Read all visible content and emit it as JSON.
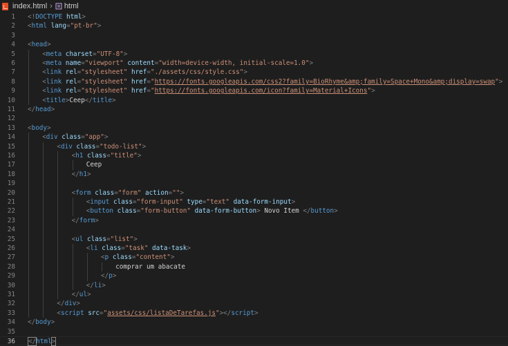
{
  "breadcrumbs": {
    "file": "index.html",
    "symbol": "html"
  },
  "editor": {
    "current_line": 36,
    "lines": [
      {
        "n": "1",
        "indent": 0,
        "tokens": [
          [
            "punct",
            "<!"
          ],
          [
            "doctype",
            "DOCTYPE"
          ],
          [
            "text",
            " "
          ],
          [
            "attr",
            "html"
          ],
          [
            "punct",
            ">"
          ]
        ]
      },
      {
        "n": "2",
        "indent": 0,
        "tokens": [
          [
            "punct",
            "<"
          ],
          [
            "tag",
            "html"
          ],
          [
            "text",
            " "
          ],
          [
            "attr",
            "lang"
          ],
          [
            "punct",
            "="
          ],
          [
            "str",
            "\"pt-br\""
          ],
          [
            "punct",
            ">"
          ]
        ]
      },
      {
        "n": "3",
        "indent": 0,
        "tokens": []
      },
      {
        "n": "4",
        "indent": 0,
        "tokens": [
          [
            "punct",
            "<"
          ],
          [
            "tag",
            "head"
          ],
          [
            "punct",
            ">"
          ]
        ]
      },
      {
        "n": "5",
        "indent": 1,
        "tokens": [
          [
            "punct",
            "<"
          ],
          [
            "tag",
            "meta"
          ],
          [
            "text",
            " "
          ],
          [
            "attr",
            "charset"
          ],
          [
            "punct",
            "="
          ],
          [
            "str",
            "\"UTF-8\""
          ],
          [
            "punct",
            ">"
          ]
        ]
      },
      {
        "n": "6",
        "indent": 1,
        "tokens": [
          [
            "punct",
            "<"
          ],
          [
            "tag",
            "meta"
          ],
          [
            "text",
            " "
          ],
          [
            "attr",
            "name"
          ],
          [
            "punct",
            "="
          ],
          [
            "str",
            "\"viewport\""
          ],
          [
            "text",
            " "
          ],
          [
            "attr",
            "content"
          ],
          [
            "punct",
            "="
          ],
          [
            "str",
            "\"width=device-width, initial-scale=1.0\""
          ],
          [
            "punct",
            ">"
          ]
        ]
      },
      {
        "n": "7",
        "indent": 1,
        "tokens": [
          [
            "punct",
            "<"
          ],
          [
            "tag",
            "link"
          ],
          [
            "text",
            " "
          ],
          [
            "attr",
            "rel"
          ],
          [
            "punct",
            "="
          ],
          [
            "str",
            "\"stylesheet\""
          ],
          [
            "text",
            " "
          ],
          [
            "attr",
            "href"
          ],
          [
            "punct",
            "="
          ],
          [
            "str",
            "\"./assets/css/style.css\""
          ],
          [
            "punct",
            ">"
          ]
        ]
      },
      {
        "n": "8",
        "indent": 1,
        "tokens": [
          [
            "punct",
            "<"
          ],
          [
            "tag",
            "link"
          ],
          [
            "text",
            " "
          ],
          [
            "attr",
            "rel"
          ],
          [
            "punct",
            "="
          ],
          [
            "str",
            "\"stylesheet\""
          ],
          [
            "text",
            " "
          ],
          [
            "attr",
            "href"
          ],
          [
            "punct",
            "="
          ],
          [
            "str",
            "\""
          ],
          [
            "link",
            "https://fonts.googleapis.com/css2?family=BioRhyme&amp;family=Space+Mono&amp;display=swap"
          ],
          [
            "str",
            "\""
          ],
          [
            "punct",
            ">"
          ]
        ]
      },
      {
        "n": "9",
        "indent": 1,
        "tokens": [
          [
            "punct",
            "<"
          ],
          [
            "tag",
            "link"
          ],
          [
            "text",
            " "
          ],
          [
            "attr",
            "rel"
          ],
          [
            "punct",
            "="
          ],
          [
            "str",
            "\"stylesheet\""
          ],
          [
            "text",
            " "
          ],
          [
            "attr",
            "href"
          ],
          [
            "punct",
            "="
          ],
          [
            "str",
            "\""
          ],
          [
            "link",
            "https://fonts.googleapis.com/icon?family=Material+Icons"
          ],
          [
            "str",
            "\""
          ],
          [
            "punct",
            ">"
          ]
        ]
      },
      {
        "n": "10",
        "indent": 1,
        "tokens": [
          [
            "punct",
            "<"
          ],
          [
            "tag",
            "title"
          ],
          [
            "punct",
            ">"
          ],
          [
            "text",
            "Ceep"
          ],
          [
            "punct",
            "</"
          ],
          [
            "tag",
            "title"
          ],
          [
            "punct",
            ">"
          ]
        ]
      },
      {
        "n": "11",
        "indent": 0,
        "tokens": [
          [
            "punct",
            "</"
          ],
          [
            "tag",
            "head"
          ],
          [
            "punct",
            ">"
          ]
        ]
      },
      {
        "n": "12",
        "indent": 0,
        "tokens": []
      },
      {
        "n": "13",
        "indent": 0,
        "tokens": [
          [
            "punct",
            "<"
          ],
          [
            "tag",
            "body"
          ],
          [
            "punct",
            ">"
          ]
        ]
      },
      {
        "n": "14",
        "indent": 1,
        "tokens": [
          [
            "punct",
            "<"
          ],
          [
            "tag",
            "div"
          ],
          [
            "text",
            " "
          ],
          [
            "attr",
            "class"
          ],
          [
            "punct",
            "="
          ],
          [
            "str",
            "\"app\""
          ],
          [
            "punct",
            ">"
          ]
        ]
      },
      {
        "n": "15",
        "indent": 2,
        "tokens": [
          [
            "punct",
            "<"
          ],
          [
            "tag",
            "div"
          ],
          [
            "text",
            " "
          ],
          [
            "attr",
            "class"
          ],
          [
            "punct",
            "="
          ],
          [
            "str",
            "\"todo-list\""
          ],
          [
            "punct",
            ">"
          ]
        ]
      },
      {
        "n": "16",
        "indent": 3,
        "tokens": [
          [
            "punct",
            "<"
          ],
          [
            "tag",
            "h1"
          ],
          [
            "text",
            " "
          ],
          [
            "attr",
            "class"
          ],
          [
            "punct",
            "="
          ],
          [
            "str",
            "\"title\""
          ],
          [
            "punct",
            ">"
          ]
        ]
      },
      {
        "n": "17",
        "indent": 4,
        "tokens": [
          [
            "text",
            "Ceep"
          ]
        ]
      },
      {
        "n": "18",
        "indent": 3,
        "tokens": [
          [
            "punct",
            "</"
          ],
          [
            "tag",
            "h1"
          ],
          [
            "punct",
            ">"
          ]
        ]
      },
      {
        "n": "19",
        "indent": 0,
        "tokens": []
      },
      {
        "n": "20",
        "indent": 3,
        "tokens": [
          [
            "punct",
            "<"
          ],
          [
            "tag",
            "form"
          ],
          [
            "text",
            " "
          ],
          [
            "attr",
            "class"
          ],
          [
            "punct",
            "="
          ],
          [
            "str",
            "\"form\""
          ],
          [
            "text",
            " "
          ],
          [
            "attr",
            "action"
          ],
          [
            "punct",
            "="
          ],
          [
            "str",
            "\"\""
          ],
          [
            "punct",
            ">"
          ]
        ]
      },
      {
        "n": "21",
        "indent": 4,
        "tokens": [
          [
            "punct",
            "<"
          ],
          [
            "tag",
            "input"
          ],
          [
            "text",
            " "
          ],
          [
            "attr",
            "class"
          ],
          [
            "punct",
            "="
          ],
          [
            "str",
            "\"form-input\""
          ],
          [
            "text",
            " "
          ],
          [
            "attr",
            "type"
          ],
          [
            "punct",
            "="
          ],
          [
            "str",
            "\"text\""
          ],
          [
            "text",
            " "
          ],
          [
            "attr",
            "data-form-input"
          ],
          [
            "punct",
            ">"
          ]
        ]
      },
      {
        "n": "22",
        "indent": 4,
        "tokens": [
          [
            "punct",
            "<"
          ],
          [
            "tag",
            "button"
          ],
          [
            "text",
            " "
          ],
          [
            "attr",
            "class"
          ],
          [
            "punct",
            "="
          ],
          [
            "str",
            "\"form-button\""
          ],
          [
            "text",
            " "
          ],
          [
            "attr",
            "data-form-button"
          ],
          [
            "punct",
            ">"
          ],
          [
            "text",
            " Novo Item "
          ],
          [
            "punct",
            "</"
          ],
          [
            "tag",
            "button"
          ],
          [
            "punct",
            ">"
          ]
        ]
      },
      {
        "n": "23",
        "indent": 3,
        "tokens": [
          [
            "punct",
            "</"
          ],
          [
            "tag",
            "form"
          ],
          [
            "punct",
            ">"
          ]
        ]
      },
      {
        "n": "24",
        "indent": 0,
        "tokens": []
      },
      {
        "n": "25",
        "indent": 3,
        "tokens": [
          [
            "punct",
            "<"
          ],
          [
            "tag",
            "ul"
          ],
          [
            "text",
            " "
          ],
          [
            "attr",
            "class"
          ],
          [
            "punct",
            "="
          ],
          [
            "str",
            "\"list\""
          ],
          [
            "punct",
            ">"
          ]
        ]
      },
      {
        "n": "26",
        "indent": 4,
        "tokens": [
          [
            "punct",
            "<"
          ],
          [
            "tag",
            "li"
          ],
          [
            "text",
            " "
          ],
          [
            "attr",
            "class"
          ],
          [
            "punct",
            "="
          ],
          [
            "str",
            "\"task\""
          ],
          [
            "text",
            " "
          ],
          [
            "attr",
            "data-task"
          ],
          [
            "punct",
            ">"
          ]
        ]
      },
      {
        "n": "27",
        "indent": 5,
        "tokens": [
          [
            "punct",
            "<"
          ],
          [
            "tag",
            "p"
          ],
          [
            "text",
            " "
          ],
          [
            "attr",
            "class"
          ],
          [
            "punct",
            "="
          ],
          [
            "str",
            "\"content\""
          ],
          [
            "punct",
            ">"
          ]
        ]
      },
      {
        "n": "28",
        "indent": 6,
        "tokens": [
          [
            "text",
            "comprar um abacate"
          ]
        ]
      },
      {
        "n": "29",
        "indent": 5,
        "tokens": [
          [
            "punct",
            "</"
          ],
          [
            "tag",
            "p"
          ],
          [
            "punct",
            ">"
          ]
        ]
      },
      {
        "n": "30",
        "indent": 4,
        "tokens": [
          [
            "punct",
            "</"
          ],
          [
            "tag",
            "li"
          ],
          [
            "punct",
            ">"
          ]
        ]
      },
      {
        "n": "31",
        "indent": 3,
        "tokens": [
          [
            "punct",
            "</"
          ],
          [
            "tag",
            "ul"
          ],
          [
            "punct",
            ">"
          ]
        ]
      },
      {
        "n": "32",
        "indent": 2,
        "tokens": [
          [
            "punct",
            "</"
          ],
          [
            "tag",
            "div"
          ],
          [
            "punct",
            ">"
          ]
        ]
      },
      {
        "n": "33",
        "indent": 2,
        "tokens": [
          [
            "punct",
            "<"
          ],
          [
            "tag",
            "script"
          ],
          [
            "text",
            " "
          ],
          [
            "attr",
            "src"
          ],
          [
            "punct",
            "="
          ],
          [
            "str",
            "\""
          ],
          [
            "link",
            "assets/css/listaDeTarefas.js"
          ],
          [
            "str",
            "\""
          ],
          [
            "punct",
            "></"
          ],
          [
            "tag",
            "script"
          ],
          [
            "punct",
            ">"
          ]
        ]
      },
      {
        "n": "34",
        "indent": 0,
        "tokens": [
          [
            "punct",
            "</"
          ],
          [
            "tag",
            "body"
          ],
          [
            "punct",
            ">"
          ]
        ]
      },
      {
        "n": "35",
        "indent": 0,
        "tokens": []
      },
      {
        "n": "36",
        "indent": 0,
        "tokens": [
          [
            "punct",
            "</"
          ],
          [
            "tag",
            "html"
          ],
          [
            "punct",
            ">"
          ]
        ]
      }
    ]
  },
  "colors": {
    "background": "#1e1e1e",
    "line_number": "#858585",
    "tag": "#569cd6",
    "attribute": "#9cdcfe",
    "string": "#ce9178",
    "punctuation": "#808080",
    "text": "#d4d4d4"
  },
  "icons": {
    "file_icon": "html-file-icon",
    "symbol_icon": "html-tag-icon"
  }
}
